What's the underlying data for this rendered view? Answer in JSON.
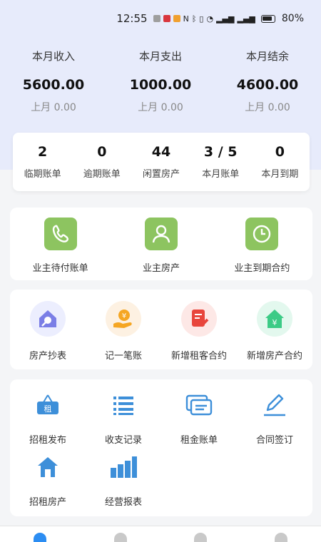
{
  "status_bar": {
    "time": "12:55",
    "battery": "80%"
  },
  "summary": [
    {
      "label": "本月收入",
      "amount": "5600.00",
      "previous": "上月 0.00"
    },
    {
      "label": "本月支出",
      "amount": "1000.00",
      "previous": "上月 0.00"
    },
    {
      "label": "本月结余",
      "amount": "4600.00",
      "previous": "上月 0.00"
    }
  ],
  "stats": [
    {
      "value": "2",
      "label": "临期账单"
    },
    {
      "value": "0",
      "label": "逾期账单"
    },
    {
      "value": "44",
      "label": "闲置房产"
    },
    {
      "value": "3 / 5",
      "label": "本月账单"
    },
    {
      "value": "0",
      "label": "本月到期"
    }
  ],
  "owner_section": [
    {
      "label": "业主待付账单",
      "icon": "phone-icon"
    },
    {
      "label": "业主房产",
      "icon": "person-icon"
    },
    {
      "label": "业主到期合约",
      "icon": "clock-icon"
    }
  ],
  "contract_section": [
    {
      "label": "房产抄表",
      "icon": "house-wrench-icon",
      "color": "#7a7ee6"
    },
    {
      "label": "记一笔账",
      "icon": "money-hand-icon",
      "color": "#f5a623"
    },
    {
      "label": "新增租客合约",
      "icon": "document-edit-icon",
      "color": "#e8453c"
    },
    {
      "label": "新增房产合约",
      "icon": "house-yen-icon",
      "color": "#3ccb86"
    }
  ],
  "tools_section": [
    {
      "label": "招租发布",
      "icon": "rent-sign-icon",
      "sign_text": "租"
    },
    {
      "label": "收支记录",
      "icon": "list-icon"
    },
    {
      "label": "租金账单",
      "icon": "bill-cards-icon"
    },
    {
      "label": "合同签订",
      "icon": "pen-sign-icon"
    },
    {
      "label": "招租房产",
      "icon": "house-icon"
    },
    {
      "label": "经营报表",
      "icon": "bar-chart-icon"
    }
  ],
  "colors": {
    "accent_blue": "#3d8fd9",
    "owner_green": "#8dc460",
    "header_bg": "#e7ebfb"
  }
}
